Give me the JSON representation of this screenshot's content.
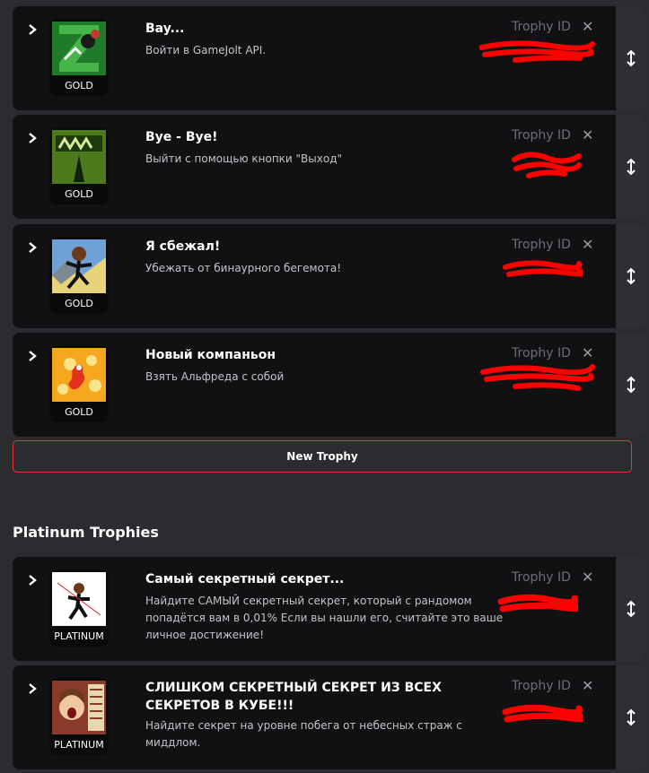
{
  "trophies_gold": [
    {
      "title": "Bay...",
      "description": "Войти в GameJolt API.",
      "tier": "GOLD",
      "trophy_id_label": "Trophy ID",
      "icon": "chevron-right-icon"
    },
    {
      "title": "Bye - Bye!",
      "description": "Выйти с помощью кнопки \"Выход\"",
      "tier": "GOLD",
      "trophy_id_label": "Trophy ID",
      "icon": "chevron-right-icon"
    },
    {
      "title": "Я сбежал!",
      "description": "Убежать от бинаурного бегемота!",
      "tier": "GOLD",
      "trophy_id_label": "Trophy ID",
      "icon": "chevron-right-icon"
    },
    {
      "title": "Новый компаньон",
      "description": "Взять Альфреда с собой",
      "tier": "GOLD",
      "trophy_id_label": "Trophy ID",
      "icon": "chevron-right-icon"
    }
  ],
  "new_trophy_label": "New Trophy",
  "platinum_section_title": "Platinum Trophies",
  "trophies_platinum": [
    {
      "title": "Самый секретный секрет...",
      "description_lines": [
        "Найдите САМЫЙ секретный секрет, который с рандомом",
        "попадётся вам в 0,01% Если вы нашли его, считайте это ваше",
        "личное достижение!"
      ],
      "tier": "PLATINUM",
      "trophy_id_label": "Trophy ID"
    },
    {
      "title_lines": [
        "СЛИШКОМ СЕКРЕТНЫЙ СЕКРЕТ ИЗ ВСЕХ",
        "СЕКРЕТОВ В КУБЕ!!!"
      ],
      "description_lines": [
        "Найдите секрет на уровне побега от небесных страж с",
        "миддлом."
      ],
      "tier": "PLATINUM",
      "trophy_id_label": "Trophy ID"
    }
  ],
  "close_glyph": "✕",
  "colors": {
    "background": "#2b2b30",
    "card": "#111114",
    "accent_border": "#e0383c",
    "redaction": "#ff0000"
  }
}
